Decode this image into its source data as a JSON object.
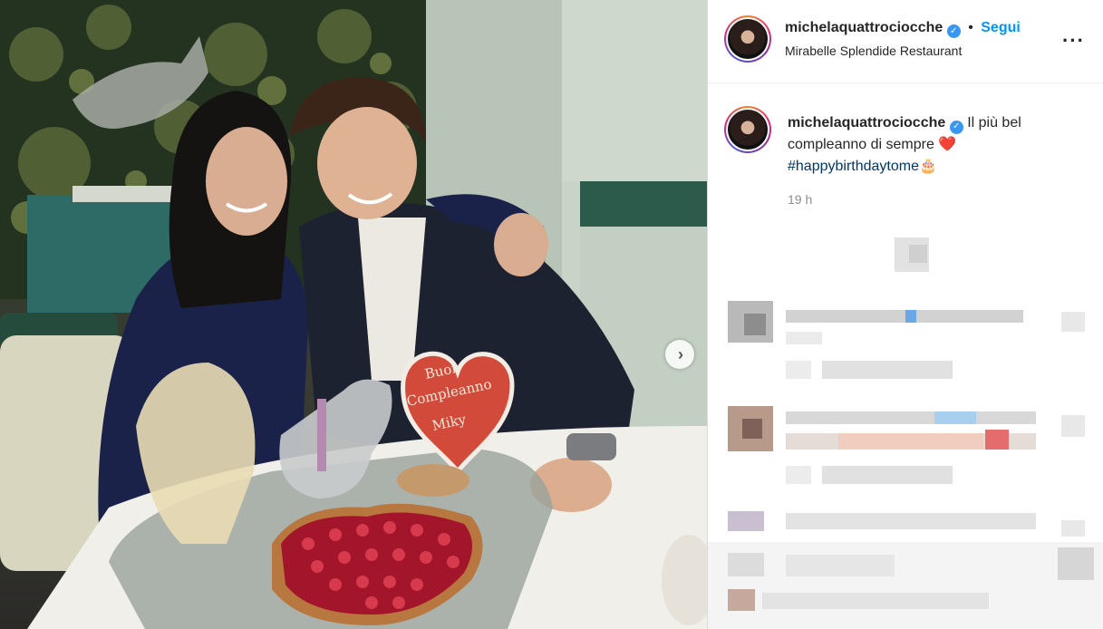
{
  "post": {
    "username": "michelaquattrociocche",
    "follow_label": "Segui",
    "location": "Mirabelle Splendide Restaurant",
    "more_label": "···",
    "caption_text": "Il più bel compleanno di sempre",
    "caption_emoji_heart": "❤️",
    "hashtag": "#happybirthdaytome",
    "hashtag_emoji": "🎂",
    "time_ago": "19 h",
    "verified_glyph": "✓"
  },
  "photo": {
    "cake_topper_text": [
      "Buon",
      "Compleanno",
      "Miky"
    ],
    "next_button_glyph": "›"
  },
  "icons": [
    "verified-badge-icon",
    "more-options-icon",
    "next-arrow-icon"
  ],
  "colors": {
    "link_blue": "#0095f6",
    "hashtag_blue": "#00376b",
    "heart_red": "#ed2d3a",
    "timestamp_gray": "#8e8e8e"
  }
}
